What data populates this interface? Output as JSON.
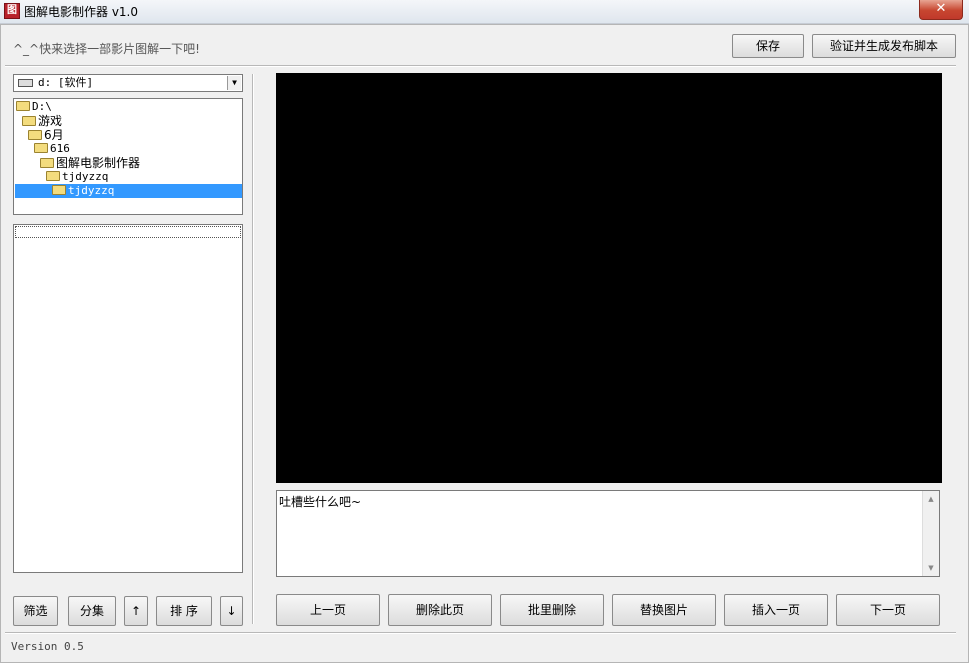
{
  "window": {
    "icon_glyph": "图",
    "title": "图解电影制作器 v1.0",
    "close_glyph": "✕"
  },
  "header": {
    "hint": "^_^快来选择一部影片图解一下吧!",
    "save_label": "保存",
    "verify_label": "验证并生成发布脚本"
  },
  "drive": {
    "value": "d: [软件]",
    "arrow": "▼"
  },
  "tree": {
    "items": [
      "D:\\",
      "游戏",
      "6月",
      "616",
      "图解电影制作器",
      "tjdyzzq",
      "tjdyzzq"
    ]
  },
  "left_buttons": {
    "filter": "筛选",
    "group": "分集",
    "up": "↑",
    "sort": "排 序",
    "down": "↓"
  },
  "comment": {
    "text": "吐槽些什么吧~"
  },
  "nav_buttons": {
    "prev": "上一页",
    "delete": "删除此页",
    "batch_delete": "批里删除",
    "replace": "替换图片",
    "insert": "插入一页",
    "next": "下一页"
  },
  "status": {
    "version": "Version 0.5"
  },
  "colors": {
    "selection": "#3399ff",
    "preview_bg": "#000000"
  }
}
